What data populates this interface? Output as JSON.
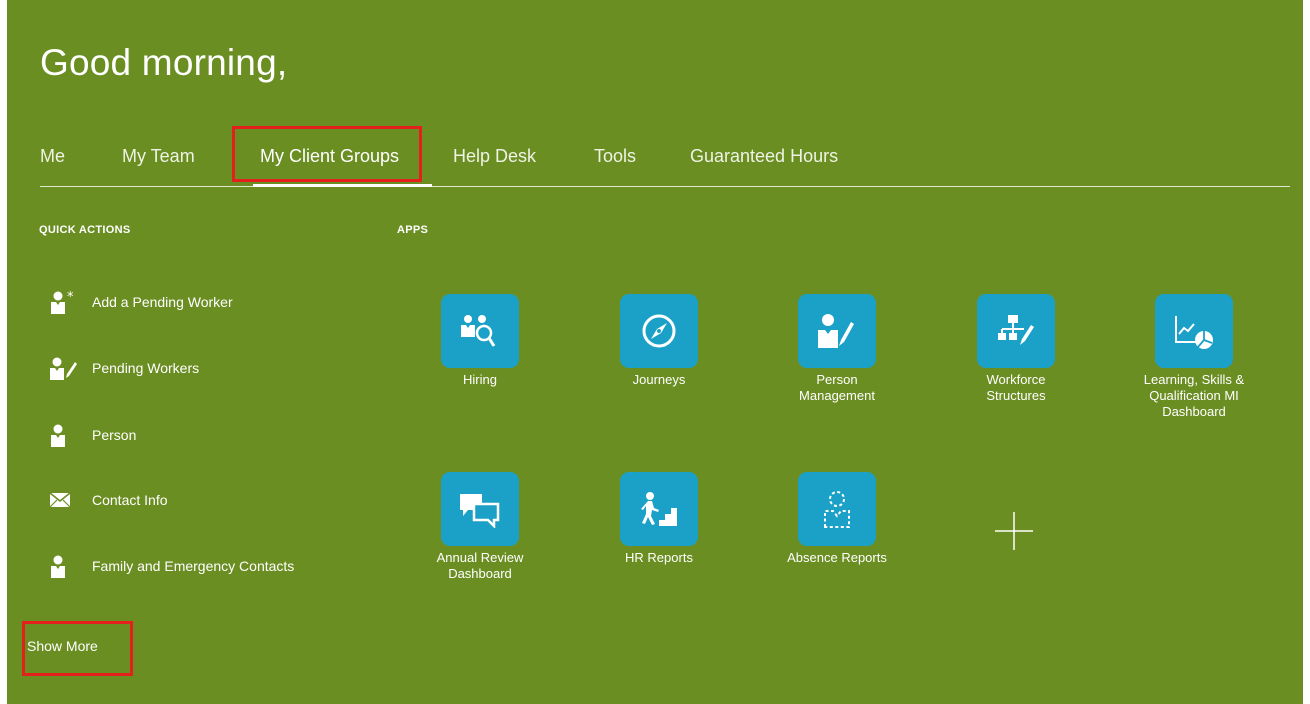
{
  "greeting": "Good morning,",
  "tabs": [
    {
      "label": "Me"
    },
    {
      "label": "My Team"
    },
    {
      "label": "My Client Groups"
    },
    {
      "label": "Help Desk"
    },
    {
      "label": "Tools"
    },
    {
      "label": "Guaranteed Hours"
    }
  ],
  "active_tab": "My Client Groups",
  "quick_actions": {
    "title": "QUICK ACTIONS",
    "items": [
      {
        "label": "Add a Pending Worker",
        "icon": "add-person-icon"
      },
      {
        "label": "Pending Workers",
        "icon": "person-edit-icon"
      },
      {
        "label": "Person",
        "icon": "person-icon"
      },
      {
        "label": "Contact Info",
        "icon": "envelope-icon"
      },
      {
        "label": "Family and Emergency Contacts",
        "icon": "person-icon"
      }
    ],
    "show_more": "Show More"
  },
  "apps": {
    "title": "APPS",
    "items": [
      {
        "label": "Hiring",
        "icon": "hiring-icon"
      },
      {
        "label": "Journeys",
        "icon": "compass-icon"
      },
      {
        "label": "Person\nManagement",
        "icon": "person-edit-icon"
      },
      {
        "label": "Workforce\nStructures",
        "icon": "org-chart-icon"
      },
      {
        "label": "Learning, Skills &\nQualification MI\nDashboard",
        "icon": "line-pie-chart-icon"
      },
      {
        "label": "Annual Review\nDashboard",
        "icon": "chat-bubbles-icon"
      },
      {
        "label": "HR Reports",
        "icon": "stairs-climber-icon"
      },
      {
        "label": "Absence Reports",
        "icon": "dashed-person-icon"
      }
    ],
    "add_icon": "plus-icon"
  },
  "colors": {
    "background": "#6b8e23",
    "tile": "#1ba1c7",
    "highlight": "#e3201b",
    "text": "#ffffff"
  }
}
